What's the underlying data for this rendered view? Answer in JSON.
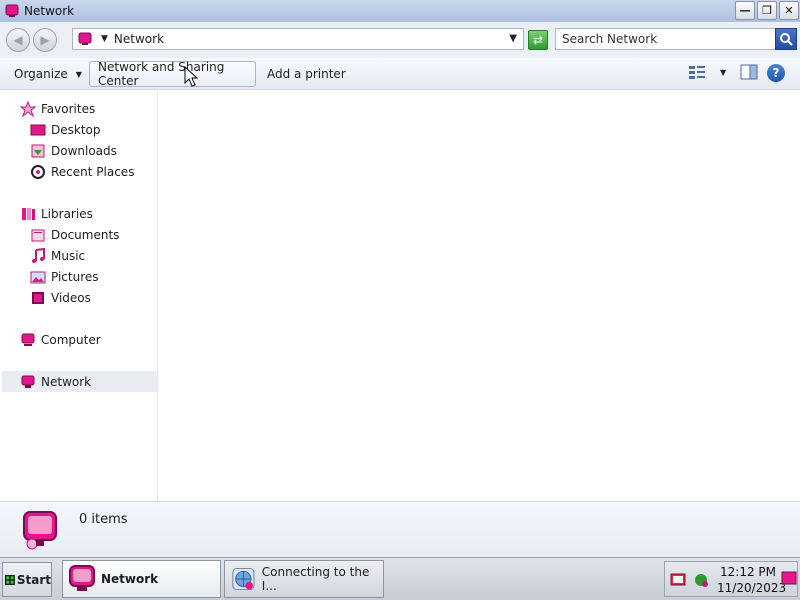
{
  "window": {
    "title": "Network"
  },
  "address": {
    "breadcrumb": "Network"
  },
  "search": {
    "placeholder": "Search Network"
  },
  "commands": {
    "organize": "Organize",
    "network_sharing": "Network and Sharing Center",
    "add_printer": "Add a printer",
    "help": "?"
  },
  "nav": {
    "favorites": "Favorites",
    "desktop": "Desktop",
    "downloads": "Downloads",
    "recent_places": "Recent Places",
    "libraries": "Libraries",
    "documents": "Documents",
    "music": "Music",
    "pictures": "Pictures",
    "videos": "Videos",
    "computer": "Computer",
    "network": "Network"
  },
  "details": {
    "item_count": "0 items"
  },
  "taskbar": {
    "start": "Start",
    "tasks": [
      {
        "label": "Network",
        "active": true
      },
      {
        "label": "Connecting to the I...",
        "active": false
      }
    ],
    "time": "12:12 PM",
    "date": "11/20/2023"
  },
  "colors": {
    "accent": "#e4168c",
    "selection": "#e9ecf1"
  }
}
